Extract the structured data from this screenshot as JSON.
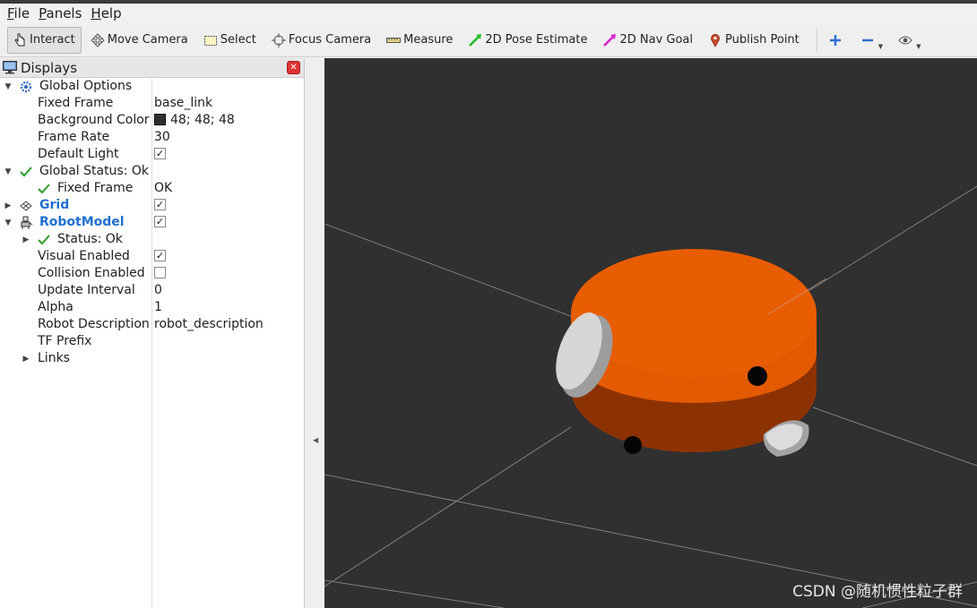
{
  "menu": {
    "file": "File",
    "file_mn": "F",
    "file_rest": "ile",
    "panels_mn": "P",
    "panels_rest": "anels",
    "help_mn": "H",
    "help_rest": "elp"
  },
  "toolbar": {
    "interact": "Interact",
    "move_camera": "Move Camera",
    "select": "Select",
    "focus_camera": "Focus Camera",
    "measure": "Measure",
    "pose_estimate": "2D Pose Estimate",
    "nav_goal": "2D Nav Goal",
    "publish_point": "Publish Point"
  },
  "panel": {
    "title": "Displays"
  },
  "tree": {
    "global_options": "Global Options",
    "fixed_frame_label": "Fixed Frame",
    "fixed_frame_value": "base_link",
    "background_color_label": "Background Color",
    "background_color_value": "48; 48; 48",
    "frame_rate_label": "Frame Rate",
    "frame_rate_value": "30",
    "default_light_label": "Default Light",
    "global_status": "Global Status: Ok",
    "status_fixed_frame_label": "Fixed Frame",
    "status_fixed_frame_value": "OK",
    "grid": "Grid",
    "robot_model": "RobotModel",
    "status_ok": "Status: Ok",
    "visual_enabled": "Visual Enabled",
    "collision_enabled": "Collision Enabled",
    "update_interval_label": "Update Interval",
    "update_interval_value": "0",
    "alpha_label": "Alpha",
    "alpha_value": "1",
    "robot_description_label": "Robot Description",
    "robot_description_value": "robot_description",
    "tf_prefix_label": "TF Prefix",
    "links": "Links"
  },
  "checks": {
    "default_light": true,
    "grid": true,
    "robot_model": true,
    "visual_enabled": true,
    "collision_enabled": false
  },
  "colors": {
    "background": "#303030",
    "robot_body": "#e85d00",
    "status_ok": "#2a9d2a",
    "link_blue": "#1f6fd1"
  },
  "watermark": "CSDN @随机惯性粒子群"
}
